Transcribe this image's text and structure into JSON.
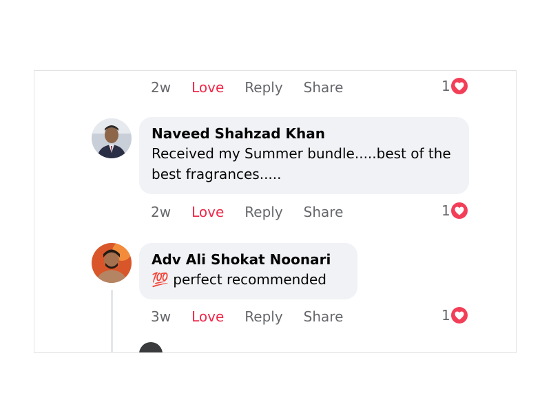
{
  "comments": [
    {
      "time": "2w",
      "love_label": "Love",
      "reply_label": "Reply",
      "share_label": "Share",
      "reaction_count": "1"
    },
    {
      "author": "Naveed Shahzad Khan",
      "text": "Received my Summer bundle.....best of the best fragrances.....",
      "time": "2w",
      "love_label": "Love",
      "reply_label": "Reply",
      "share_label": "Share",
      "reaction_count": "1"
    },
    {
      "author": "Adv Ali Shokat Noonari",
      "emoji": "💯",
      "text": "perfect recommended",
      "time": "3w",
      "love_label": "Love",
      "reply_label": "Reply",
      "share_label": "Share",
      "reaction_count": "1"
    }
  ],
  "colors": {
    "love": "#f0284a",
    "heart_badge": "#f33e58",
    "bubble": "#f0f2f5",
    "meta": "#65676b"
  },
  "icons": {
    "reaction": "heart-icon",
    "avatar": "profile-avatar"
  }
}
